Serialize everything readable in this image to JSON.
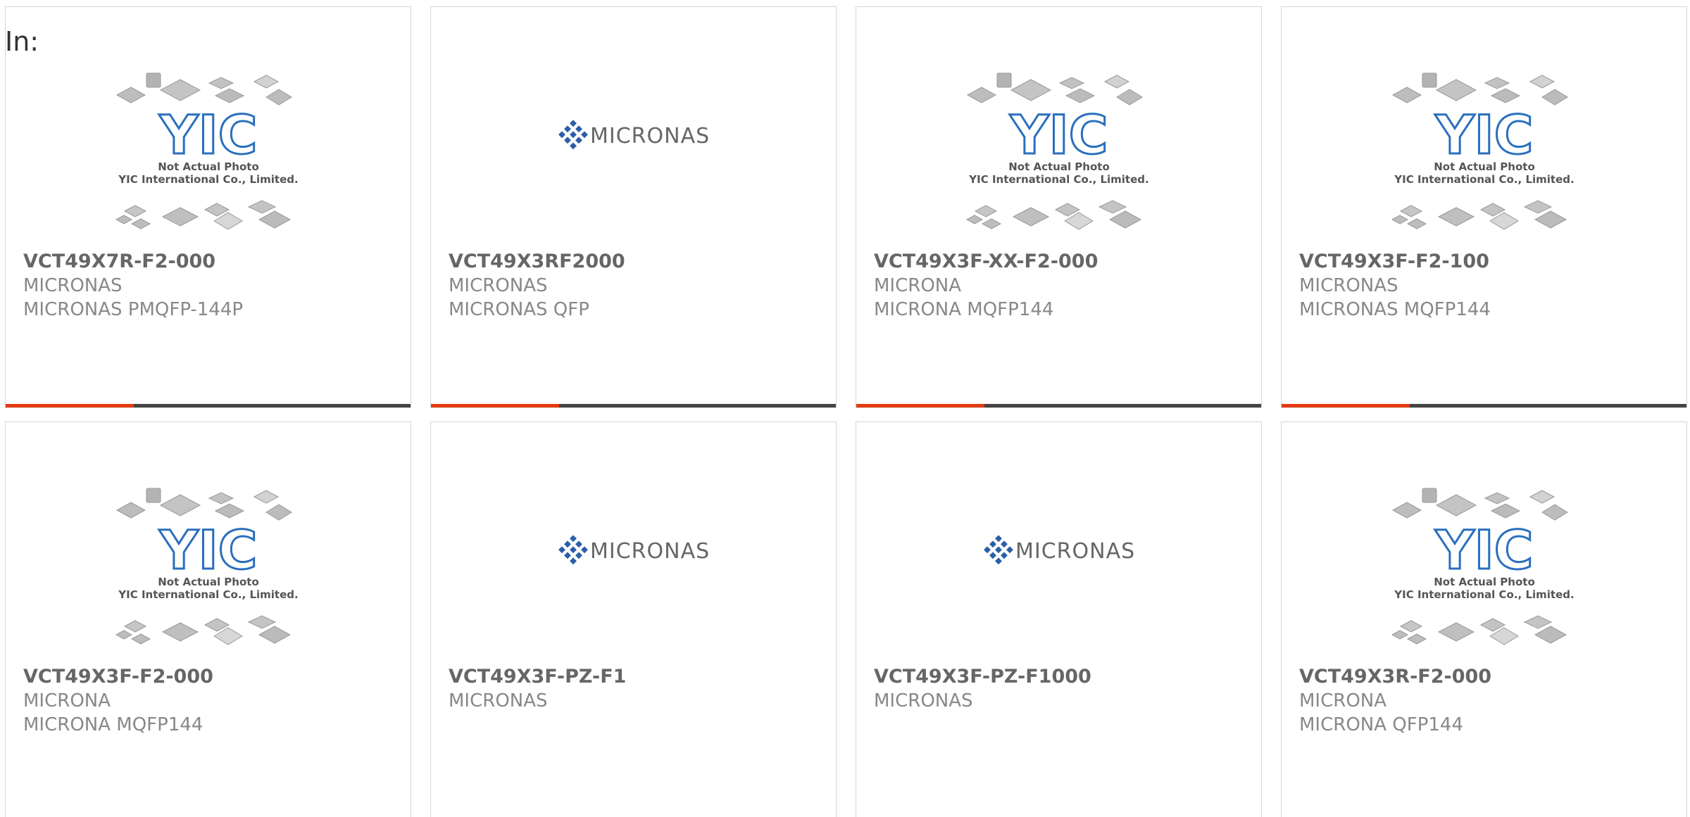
{
  "header": {
    "label": "In:"
  },
  "colors": {
    "accent": "#e63a12",
    "bar": "#444444",
    "text_bold": "#666666",
    "text": "#888888"
  },
  "products": [
    {
      "part": "VCT49X7R-F2-000",
      "manufacturer": "MICRONAS",
      "package": "MICRONAS PMQFP-144P",
      "image": "yic-placeholder",
      "image_text": [
        "Not Actual Photo",
        "YIC International Co., Limited."
      ]
    },
    {
      "part": "VCT49X3RF2000",
      "manufacturer": "MICRONAS",
      "package": "MICRONAS QFP",
      "image": "micronas-logo",
      "image_text": [
        "MICRONAS"
      ]
    },
    {
      "part": "VCT49X3F-XX-F2-000",
      "manufacturer": "MICRONA",
      "package": "MICRONA MQFP144",
      "image": "yic-placeholder",
      "image_text": [
        "Not Actual Photo",
        "YIC International Co., Limited."
      ]
    },
    {
      "part": "VCT49X3F-F2-100",
      "manufacturer": "MICRONAS",
      "package": "MICRONAS MQFP144",
      "image": "yic-placeholder",
      "image_text": [
        "Not Actual Photo",
        "YIC International Co., Limited."
      ]
    },
    {
      "part": "VCT49X3F-F2-000",
      "manufacturer": "MICRONA",
      "package": "MICRONA MQFP144",
      "image": "yic-placeholder",
      "image_text": [
        "Not Actual Photo",
        "YIC International Co., Limited."
      ]
    },
    {
      "part": "VCT49X3F-PZ-F1",
      "manufacturer": "MICRONAS",
      "package": "",
      "image": "micronas-logo",
      "image_text": [
        "MICRONAS"
      ]
    },
    {
      "part": "VCT49X3F-PZ-F1000",
      "manufacturer": "MICRONAS",
      "package": "",
      "image": "micronas-logo",
      "image_text": [
        "MICRONAS"
      ]
    },
    {
      "part": "VCT49X3R-F2-000",
      "manufacturer": "MICRONA",
      "package": "MICRONA QFP144",
      "image": "yic-placeholder",
      "image_text": [
        "Not Actual Photo",
        "YIC International Co., Limited."
      ]
    }
  ]
}
